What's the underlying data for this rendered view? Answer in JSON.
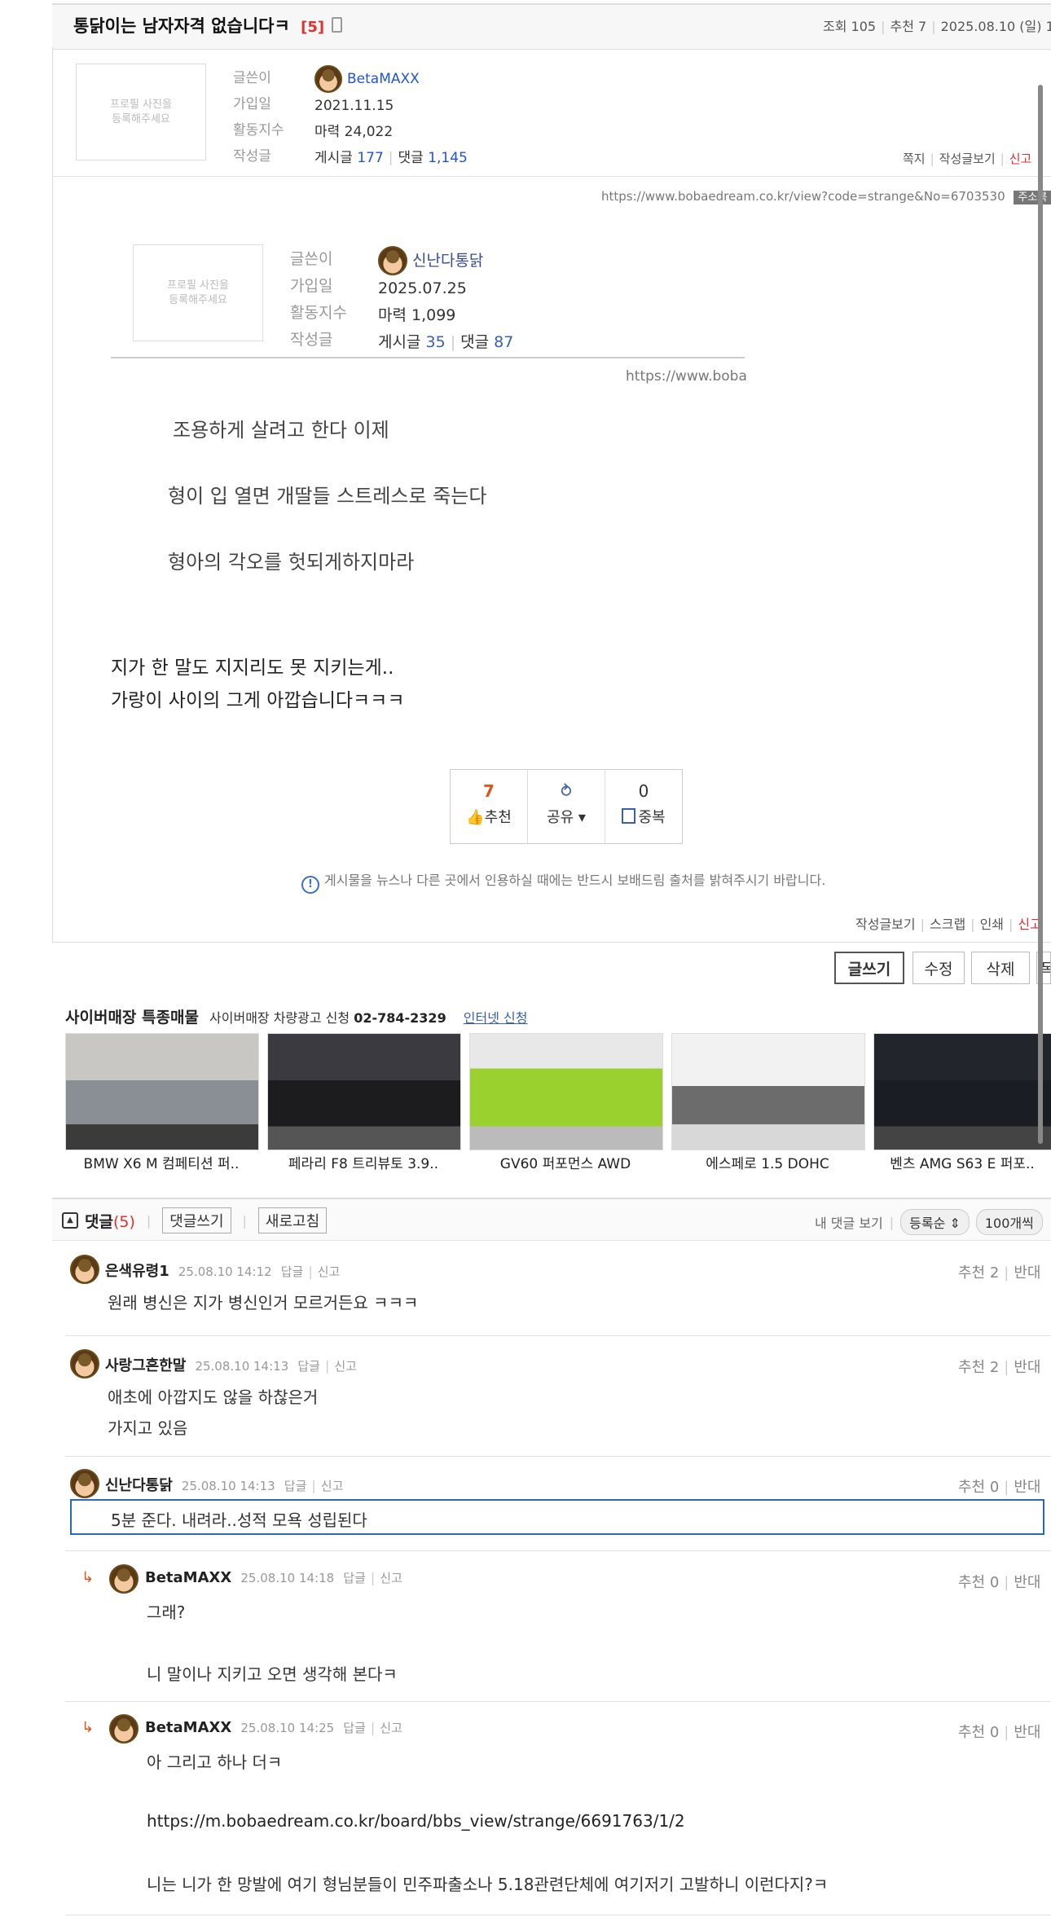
{
  "post": {
    "title": "통닭이는 남자자격 없습니다ㅋ",
    "comment_count": "[5]",
    "views": "조회 105",
    "recommends": "추천 7",
    "date": "2025.08.10 (일) 14:",
    "url": "https://www.bobaedream.co.kr/view?code=strange&No=6703530",
    "url_copy": "주소복"
  },
  "author": {
    "profile_placeholder": "프로필 사진을\n등록해주세요",
    "labels": {
      "writer": "글쓴이",
      "joined": "가입일",
      "activity": "활동지수",
      "posts": "작성글"
    },
    "name": "BetaMAXX",
    "joined": "2021.11.15",
    "activity": "마력 24,022",
    "posts_label": "게시글",
    "posts_count": "177",
    "comments_label": "댓글",
    "comments_count": "1,145",
    "actions": [
      "쪽지",
      "작성글보기",
      "신고"
    ]
  },
  "quoted": {
    "profile_placeholder": "프로필 사진을\n등록해주세요",
    "labels": {
      "writer": "글쓴이",
      "joined": "가입일",
      "activity": "활동지수",
      "posts": "작성글"
    },
    "name": "신난다통닭",
    "joined": "2025.07.25",
    "activity": "마력 1,099",
    "posts_label": "게시글",
    "posts_count": "35",
    "comments_label": "댓글",
    "comments_count": "87",
    "url": "https://www.boba",
    "lines": [
      "조용하게 살려고 한다 이제",
      "형이 입 열면 개딸들 스트레스로 죽는다",
      "형아의 각오를 헛되게하지마라"
    ]
  },
  "body": {
    "lines": [
      "지가 한 말도 지지리도 못 지키는게..",
      "가랑이 사이의 그게 아깝습니다ㅋㅋㅋ"
    ]
  },
  "votes": {
    "recommend_count": "7",
    "recommend_label": "추천",
    "share_label": "공유 ▾",
    "dup_count": "0",
    "dup_label": "중복"
  },
  "notice": "게시물을 뉴스나 다른 곳에서 인용하실 때에는 반드시 보배드림 출처를 밝혀주시기 바랍니다.",
  "post_actions": [
    "작성글보기",
    "스크랩",
    "인쇄",
    "신고"
  ],
  "buttons": {
    "write": "글쓰기",
    "edit": "수정",
    "delete": "삭제",
    "list": "목"
  },
  "ads": {
    "title": "사이버매장 특종매물",
    "sub": "사이버매장 차량광고 신청",
    "phone": "02-784-2329",
    "link": "인터넷 신청",
    "cars": [
      {
        "name": "BMW X6 M 컴페티션 퍼..",
        "color": "#8a8f96"
      },
      {
        "name": "페라리 F8 트리뷰토 3.9..",
        "color": "#1c1c1e"
      },
      {
        "name": "GV60 퍼포먼스 AWD",
        "color": "#9bd12e"
      },
      {
        "name": "에스페로 1.5 DOHC",
        "color": "#6c6c6c"
      },
      {
        "name": "벤츠 AMG S63 E 퍼포..",
        "color": "#1a1d24"
      }
    ]
  },
  "comments_header": {
    "label": "댓글",
    "count": "(5)",
    "write": "댓글쓰기",
    "refresh": "새로고침",
    "my_comments": "내 댓글 보기",
    "sort": "등록순",
    "per_page": "100개씩"
  },
  "comments": [
    {
      "name": "은색유령1",
      "meta": "25.08.10 14:12",
      "reply": "답글",
      "report": "신고",
      "votes": "추천 2",
      "against": "반대",
      "lines": [
        "원래 병신은 지가 병신인거 모르거든요 ㅋㅋㅋ"
      ]
    },
    {
      "name": "사랑그흔한말",
      "meta": "25.08.10 14:13",
      "reply": "답글",
      "report": "신고",
      "votes": "추천 2",
      "against": "반대",
      "lines": [
        "애초에 아깝지도 않을 하찮은거",
        "가지고 있음"
      ]
    },
    {
      "name": "신난다통닭",
      "meta": "25.08.10 14:13",
      "reply": "답글",
      "report": "신고",
      "votes": "추천 0",
      "against": "반대",
      "lines": [
        "5분 준다. 내려라..성적 모욕 성립된다"
      ]
    },
    {
      "name": "BetaMAXX",
      "meta": "25.08.10 14:18",
      "reply": "답글",
      "report": "신고",
      "votes": "추천 0",
      "against": "반대",
      "lines": [
        "그래?",
        "니 말이나 지키고 오면 생각해 본다ㅋ"
      ]
    },
    {
      "name": "BetaMAXX",
      "meta": "25.08.10 14:25",
      "reply": "답글",
      "report": "신고",
      "votes": "추천 0",
      "against": "반대",
      "lines": [
        "아 그리고 하나 더ㅋ",
        "https://m.bobaedream.co.kr/board/bbs_view/strange/6691763/1/2",
        "니는 니가 한 망발에 여기 형님분들이 민주파출소나 5.18관련단체에 여기저기 고발하니 이런다지?ㅋ"
      ]
    }
  ]
}
